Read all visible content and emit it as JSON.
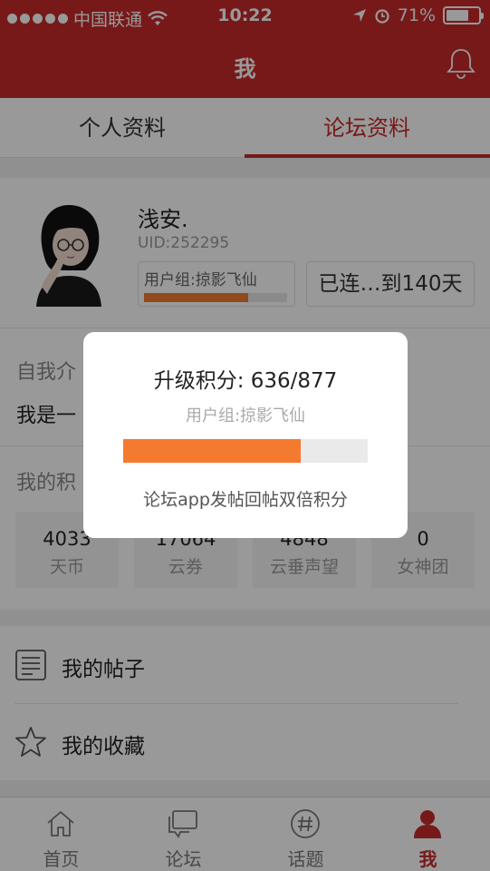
{
  "status_bar": {
    "carrier": "中国联通",
    "time": "10:22",
    "battery": "71%",
    "battery_level": 0.71
  },
  "header": {
    "title": "我",
    "bell_icon": "bell-icon"
  },
  "tabs": [
    {
      "label": "个人资料",
      "active": false
    },
    {
      "label": "论坛资料",
      "active": true
    }
  ],
  "profile": {
    "name": "浅安.",
    "uid": "UID:252295",
    "group": "用户组:掠影飞仙",
    "group_progress": 0.725,
    "streak": "已连…到140天"
  },
  "intro": {
    "label": "自我介",
    "text": "我是一"
  },
  "points": {
    "label": "我的积",
    "stats": [
      {
        "value": "4033",
        "label": "天币"
      },
      {
        "value": "17064",
        "label": "云券"
      },
      {
        "value": "4848",
        "label": "云垂声望"
      },
      {
        "value": "0",
        "label": "女神团"
      }
    ]
  },
  "menu": [
    {
      "label": "我的帖子",
      "icon": "document-icon"
    },
    {
      "label": "我的收藏",
      "icon": "star-icon"
    }
  ],
  "tabbar": [
    {
      "label": "首页",
      "icon": "home-icon",
      "active": false
    },
    {
      "label": "论坛",
      "icon": "chat-icon",
      "active": false
    },
    {
      "label": "话题",
      "icon": "hashtag-icon",
      "active": false
    },
    {
      "label": "我",
      "icon": "person-icon",
      "active": true
    }
  ],
  "dialog": {
    "title": "升级积分: 636/877",
    "group": "用户组:掠影飞仙",
    "progress": 0.725,
    "note": "论坛app发帖回帖双倍积分"
  },
  "colors": {
    "brand": "#c62a2a",
    "progress": "#f47a30"
  }
}
